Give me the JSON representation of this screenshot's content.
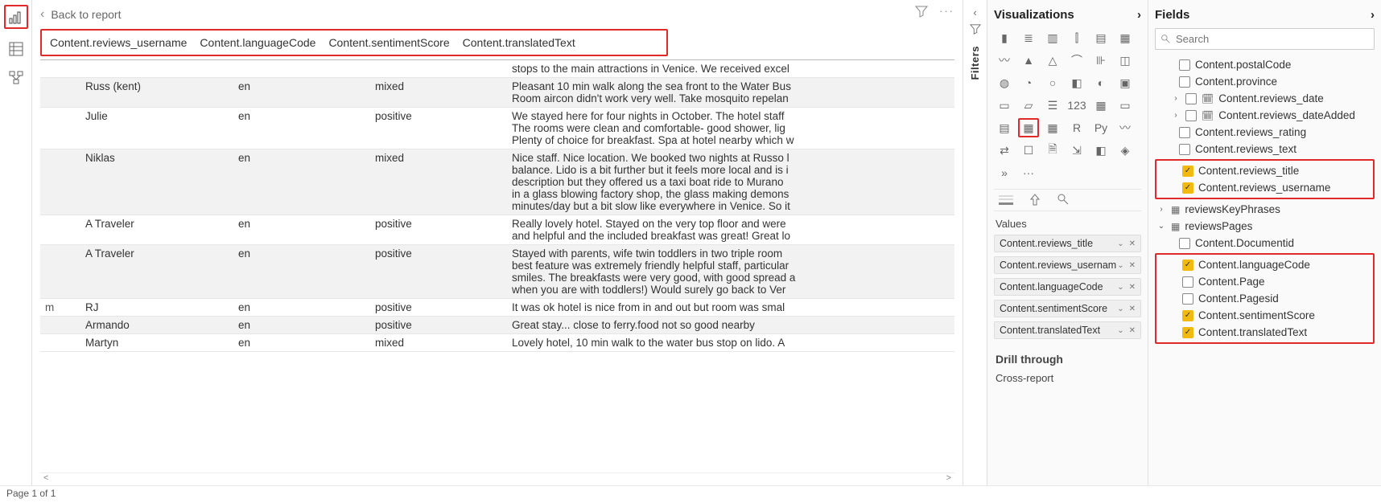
{
  "leftRail": {
    "view1": "chart-view",
    "view2": "table-view",
    "view3": "model-view"
  },
  "nav": {
    "back": "Back to report"
  },
  "filtersLabel": "Filters",
  "columns": [
    "Content.reviews_username",
    "Content.languageCode",
    "Content.sentimentScore",
    "Content.translatedText"
  ],
  "rows": [
    {
      "c0": "",
      "user": "",
      "lang": "",
      "score": "",
      "text": "stops to the main attractions in Venice. We received excel",
      "alt": false
    },
    {
      "c0": "",
      "user": "Russ (kent)",
      "lang": "en",
      "score": "mixed",
      "text": "Pleasant 10 min walk along the sea front to the Water Bus\nRoom aircon didn't work very well. Take mosquito repelan",
      "alt": true
    },
    {
      "c0": "",
      "user": "Julie",
      "lang": "en",
      "score": "positive",
      "text": "We stayed here for four nights in October. The hotel staff\nThe rooms were clean and comfortable- good shower, lig\nPlenty of choice for breakfast. Spa at hotel nearby which w",
      "alt": false
    },
    {
      "c0": "",
      "user": "Niklas",
      "lang": "en",
      "score": "mixed",
      "text": "Nice staff. Nice location. We booked two nights at Russo l\nbalance. Lido is a bit further but it feels more local and is i\ndescription but they offered us a taxi boat ride to Murano\nin a glass blowing factory shop, the glass making demons\nminutes/day but a bit slow like everywhere in Venice. So it",
      "alt": true
    },
    {
      "c0": "",
      "user": "A Traveler",
      "lang": "en",
      "score": "positive",
      "text": "Really lovely hotel. Stayed on the very top floor and were\nand helpful and the included breakfast was great! Great lo",
      "alt": false
    },
    {
      "c0": "",
      "user": "A Traveler",
      "lang": "en",
      "score": "positive",
      "text": "Stayed with parents, wife twin toddlers in two triple room\nbest feature was extremely friendly helpful staff, particular\nsmiles. The breakfasts were very good, with good spread a\nwhen you are with toddlers!) Would surely go back to Ver",
      "alt": true
    },
    {
      "c0": "m",
      "user": "RJ",
      "lang": "en",
      "score": "positive",
      "text": "It was ok hotel is nice from in and out but room was smal",
      "alt": false
    },
    {
      "c0": "",
      "user": "Armando",
      "lang": "en",
      "score": "positive",
      "text": "Great stay... close to ferry.food not so good nearby",
      "alt": true
    },
    {
      "c0": "",
      "user": "Martyn",
      "lang": "en",
      "score": "mixed",
      "text": "Lovely hotel, 10 min walk to the water bus stop on lido. A",
      "alt": false
    }
  ],
  "viz": {
    "title": "Visualizations",
    "valuesLabel": "Values",
    "values": [
      "Content.reviews_title",
      "Content.reviews_usernam",
      "Content.languageCode",
      "Content.sentimentScore",
      "Content.translatedText"
    ],
    "drillTitle": "Drill through",
    "crossReport": "Cross-report"
  },
  "fields": {
    "title": "Fields",
    "searchPlaceholder": "Search",
    "items": [
      {
        "label": "Content.postalCode",
        "checked": false,
        "indent": "ind2"
      },
      {
        "label": "Content.province",
        "checked": false,
        "indent": "ind2"
      },
      {
        "label": "Content.reviews_date",
        "checked": false,
        "indent": "ind1",
        "expand": true,
        "icon": "date"
      },
      {
        "label": "Content.reviews_dateAdded",
        "checked": false,
        "indent": "ind1",
        "expand": true,
        "icon": "date"
      },
      {
        "label": "Content.reviews_rating",
        "checked": false,
        "indent": "ind2"
      },
      {
        "label": "Content.reviews_text",
        "checked": false,
        "indent": "ind2"
      }
    ],
    "hl1": [
      {
        "label": "Content.reviews_title",
        "checked": true,
        "indent": "ind2"
      },
      {
        "label": "Content.reviews_username",
        "checked": true,
        "indent": "ind2"
      }
    ],
    "tables": [
      {
        "label": "reviewsKeyPhrases",
        "expand": ">",
        "indent": "ind0"
      },
      {
        "label": "reviewsPages",
        "expand": "v",
        "indent": "ind0"
      }
    ],
    "pagesKids": [
      {
        "label": "Content.Documentid",
        "checked": false
      }
    ],
    "hl2": [
      {
        "label": "Content.languageCode",
        "checked": true
      },
      {
        "label": "Content.Page",
        "checked": false
      },
      {
        "label": "Content.Pagesid",
        "checked": false
      },
      {
        "label": "Content.sentimentScore",
        "checked": true
      },
      {
        "label": "Content.translatedText",
        "checked": true
      }
    ]
  },
  "footer": "Page 1 of 1"
}
